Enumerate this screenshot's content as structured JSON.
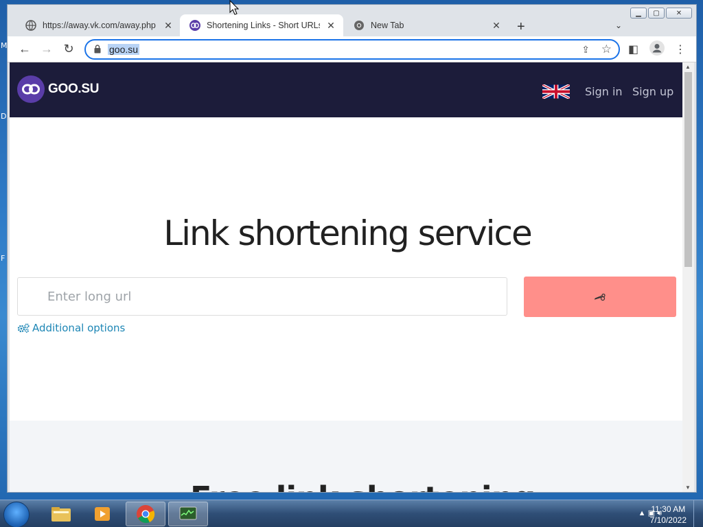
{
  "desktop": {
    "side_letters": [
      "M",
      "D",
      "F"
    ]
  },
  "browser": {
    "tabs": [
      {
        "title": "https://away.vk.com/away.php",
        "active": false
      },
      {
        "title": "Shortening Links - Short URLs | G",
        "active": true
      },
      {
        "title": "New Tab",
        "active": false
      }
    ],
    "address": "goo.su"
  },
  "site": {
    "logo_text": "GOO.SU",
    "nav": {
      "sign_in": "Sign in",
      "sign_up": "Sign up"
    },
    "hero_title": "Link shortening service",
    "input_placeholder": "Enter long url",
    "additional_options": "Additional options",
    "partial_heading": "Free link shortening",
    "colors": {
      "header_bg": "#1c1c3a",
      "button": "#ff8f8a",
      "link": "#1d86b5"
    }
  },
  "taskbar": {
    "time": "11:30 AM",
    "date": "7/10/2022"
  }
}
